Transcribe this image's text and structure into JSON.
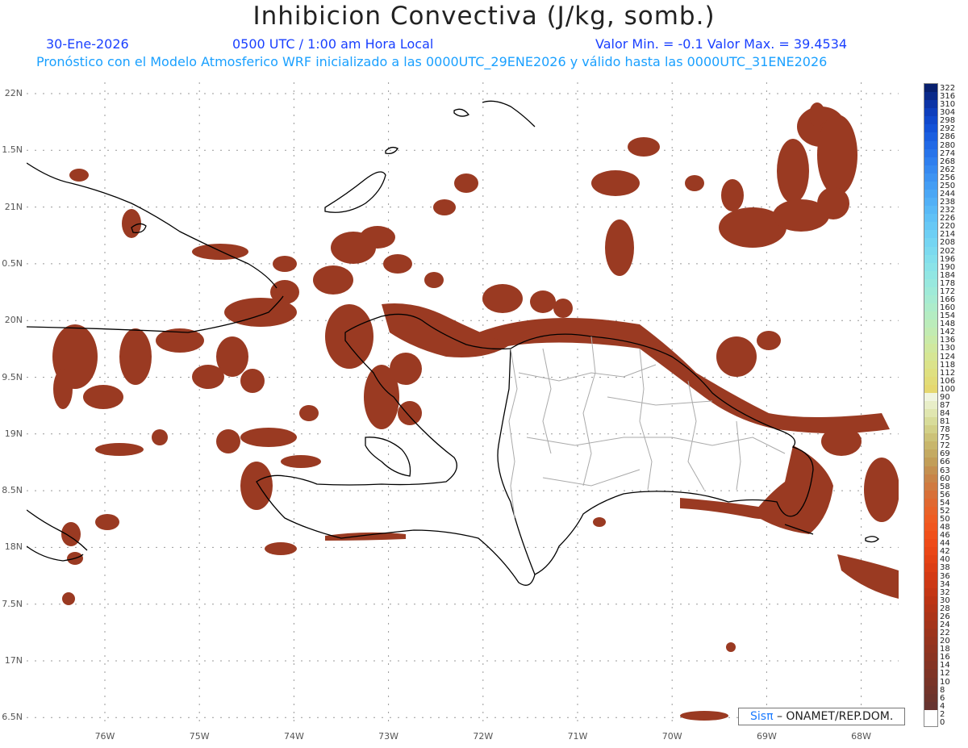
{
  "title": "Inhibicion Convectiva (J/kg, somb.)",
  "date": "30-Ene-2026",
  "time": "0500 UTC / 1:00 am Hora Local",
  "minmax": "Valor Min. = -0.1  Valor Max. = 39.4534",
  "model_info": "Pronóstico con el Modelo Atmosferico WRF inicializado a las 0000UTC_29ENE2026 y válido hasta las  0000UTC_31ENE2026",
  "credit": {
    "sis": "Sisπ",
    "rest": " – ONAMET/REP.DOM."
  },
  "map": {
    "lat_labels": [
      "22N",
      "1.5N",
      "21N",
      "0.5N",
      "20N",
      "9.5N",
      "19N",
      "8.5N",
      "18N",
      "7.5N",
      "17N",
      "6.5N"
    ],
    "lon_labels": [
      "76W",
      "75W",
      "74W",
      "73W",
      "72W",
      "71W",
      "70W",
      "69W",
      "68W"
    ],
    "field_color": "#9a3a22",
    "coast_color": "#000000",
    "border_color": "#aaaaaa"
  },
  "colorbar": {
    "labels": [
      "322",
      "316",
      "310",
      "304",
      "298",
      "292",
      "286",
      "280",
      "274",
      "268",
      "262",
      "256",
      "250",
      "244",
      "238",
      "232",
      "226",
      "220",
      "214",
      "208",
      "202",
      "196",
      "190",
      "184",
      "178",
      "172",
      "166",
      "160",
      "154",
      "148",
      "142",
      "136",
      "130",
      "124",
      "118",
      "112",
      "106",
      "100",
      "90",
      "87",
      "84",
      "81",
      "78",
      "75",
      "72",
      "69",
      "66",
      "63",
      "60",
      "58",
      "56",
      "54",
      "52",
      "50",
      "48",
      "46",
      "44",
      "42",
      "40",
      "38",
      "36",
      "34",
      "32",
      "30",
      "28",
      "26",
      "24",
      "22",
      "20",
      "18",
      "16",
      "14",
      "12",
      "10",
      "8",
      "6",
      "4",
      "2",
      "0"
    ],
    "colors": [
      "#08206e",
      "#0a2a8a",
      "#0c34a6",
      "#0e3ebc",
      "#1048cc",
      "#1352d8",
      "#1a5ee0",
      "#2169e6",
      "#2874ea",
      "#2f7fee",
      "#3689f0",
      "#3d93f2",
      "#449df4",
      "#4ba7f5",
      "#52b0f6",
      "#59b9f6",
      "#60c1f6",
      "#67c8f5",
      "#6ecff4",
      "#75d5f2",
      "#7cdaef",
      "#83dfec",
      "#8ae3e8",
      "#91e6e3",
      "#98e8de",
      "#9fead8",
      "#a6ebd2",
      "#adecca",
      "#b4ecc2",
      "#bbecba",
      "#c2ebb2",
      "#c9eaa8",
      "#d0e89e",
      "#d6e694",
      "#dbe38a",
      "#dfe080",
      "#e2dc78",
      "#e5d870",
      "#f0f5e0",
      "#e8eec8",
      "#e0e6b0",
      "#d8dc9a",
      "#d2d088",
      "#ccc278",
      "#c8b66c",
      "#c4aa62",
      "#c29e58",
      "#c49050",
      "#c88448",
      "#d07a40",
      "#d87038",
      "#e06830",
      "#e86228",
      "#ee5c22",
      "#f0561e",
      "#f0501a",
      "#ee4a18",
      "#ea4616",
      "#e44214",
      "#dc3e14",
      "#d43a14",
      "#cc3814",
      "#c43614",
      "#bc3414",
      "#b43416",
      "#ac3418",
      "#a4341a",
      "#9c341c",
      "#96341e",
      "#903420",
      "#8a3422",
      "#843424",
      "#7e3426",
      "#783428",
      "#72342a",
      "#6c342c",
      "#663430",
      "#ffffff",
      "#ffffff"
    ]
  }
}
